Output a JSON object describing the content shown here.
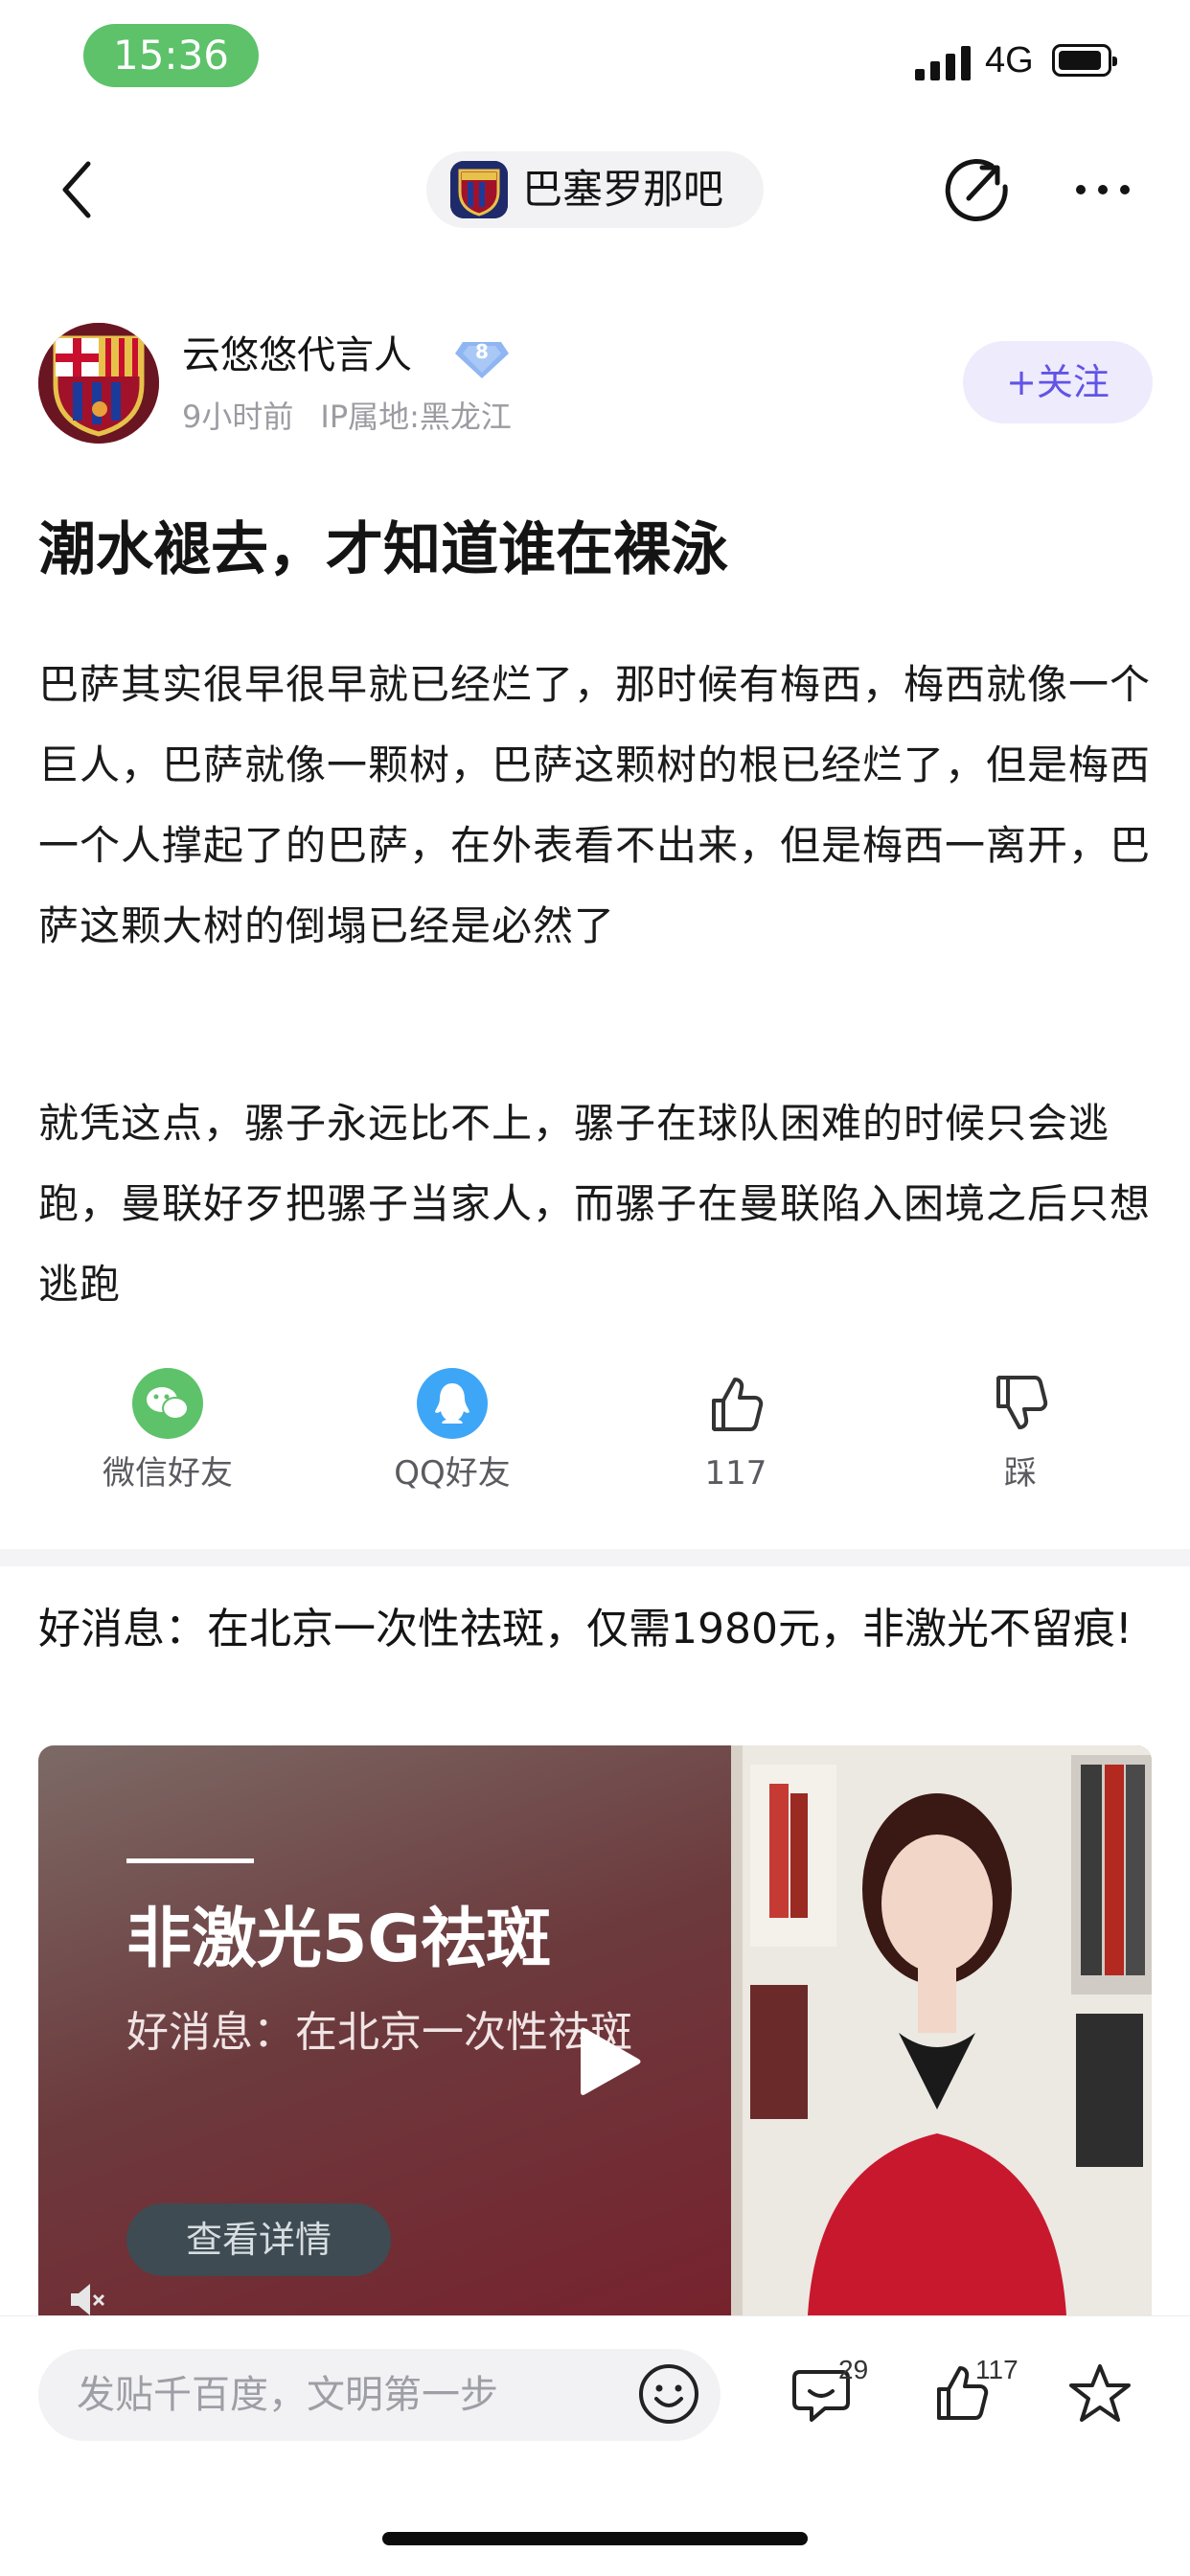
{
  "status": {
    "time": "15:36",
    "network": "4G"
  },
  "nav": {
    "forum_name": "巴塞罗那吧"
  },
  "author": {
    "name": "云悠悠代言人",
    "level": "8",
    "time_ago": "9小时前",
    "ip_location": "IP属地:黑龙江",
    "follow_label": "+关注"
  },
  "post": {
    "title": "潮水褪去，才知道谁在裸泳",
    "paragraphs": [
      "巴萨其实很早很早就已经烂了，那时候有梅西，梅西就像一个巨人，巴萨就像一颗树，巴萨这颗树的根已经烂了，但是梅西一个人撑起了的巴萨，在外表看不出来，但是梅西一离开，巴萨这颗大树的倒塌已经是必然了",
      "就凭这点，骡子永远比不上，骡子在球队困难的时候只会逃跑，曼联好歹把骡子当家人，而骡子在曼联陷入困境之后只想逃跑"
    ]
  },
  "actions": [
    {
      "label": "微信好友",
      "icon": "wechat-icon"
    },
    {
      "label": "QQ好友",
      "icon": "qq-icon"
    },
    {
      "label": "117",
      "icon": "thumbs-up-icon"
    },
    {
      "label": "踩",
      "icon": "thumbs-down-icon"
    }
  ],
  "ad": {
    "title": "好消息：在北京一次性祛斑，仅需1980元，非激光不留痕!",
    "headline": "非激光5G祛斑",
    "subtext": "好消息：在北京一次性祛斑",
    "button": "查看详情"
  },
  "bottom_bar": {
    "input_placeholder": "发贴千百度，文明第一步",
    "comment_count": "29",
    "like_count": "117"
  },
  "colors": {
    "accent": "#6154e6",
    "status_green": "#5dc26a",
    "wechat": "#5dc26a",
    "qq": "#3ea6f7"
  }
}
